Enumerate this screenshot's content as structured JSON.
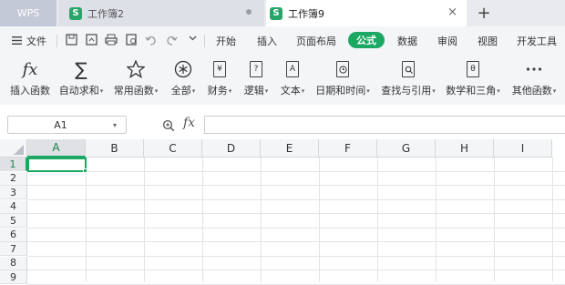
{
  "titlebar": {
    "app_label": "WPS",
    "tabs": [
      {
        "label": "工作簿2",
        "logo": "S"
      },
      {
        "label": "工作簿9",
        "logo": "S"
      }
    ],
    "close_glyph": "×",
    "new_tab_glyph": "+"
  },
  "menubar": {
    "file_label": "文件",
    "tabs": [
      "开始",
      "插入",
      "页面布局",
      "公式",
      "数据",
      "审阅",
      "视图",
      "开发工具"
    ],
    "active_tab": "公式"
  },
  "ribbon": {
    "buttons": [
      {
        "label": "插入函数",
        "icon": "fx-icon"
      },
      {
        "label": "自动求和",
        "icon": "sigma-icon",
        "dropdown": true
      },
      {
        "label": "常用函数",
        "icon": "star-icon",
        "dropdown": true
      },
      {
        "label": "全部",
        "icon": "asterisk-circle-icon",
        "dropdown": true
      },
      {
        "label": "财务",
        "icon": "yen-doc-icon",
        "dropdown": true
      },
      {
        "label": "逻辑",
        "icon": "question-doc-icon",
        "dropdown": true
      },
      {
        "label": "文本",
        "icon": "a-doc-icon",
        "dropdown": true
      },
      {
        "label": "日期和时间",
        "icon": "clock-doc-icon",
        "dropdown": true
      },
      {
        "label": "查找与引用",
        "icon": "search-doc-icon",
        "dropdown": true
      },
      {
        "label": "数学和三角",
        "icon": "theta-doc-icon",
        "dropdown": true
      },
      {
        "label": "其他函数",
        "icon": "more-icon",
        "dropdown": true
      }
    ]
  },
  "formula_bar": {
    "name_box_value": "A1",
    "fx_label": "fx",
    "formula_value": ""
  },
  "sheet": {
    "columns": [
      "A",
      "B",
      "C",
      "D",
      "E",
      "F",
      "G",
      "H",
      "I"
    ],
    "rows": [
      "1",
      "2",
      "3",
      "4",
      "5",
      "6",
      "7",
      "8",
      "9"
    ],
    "selected_cell": "A1",
    "accent_color": "#1aa862"
  }
}
